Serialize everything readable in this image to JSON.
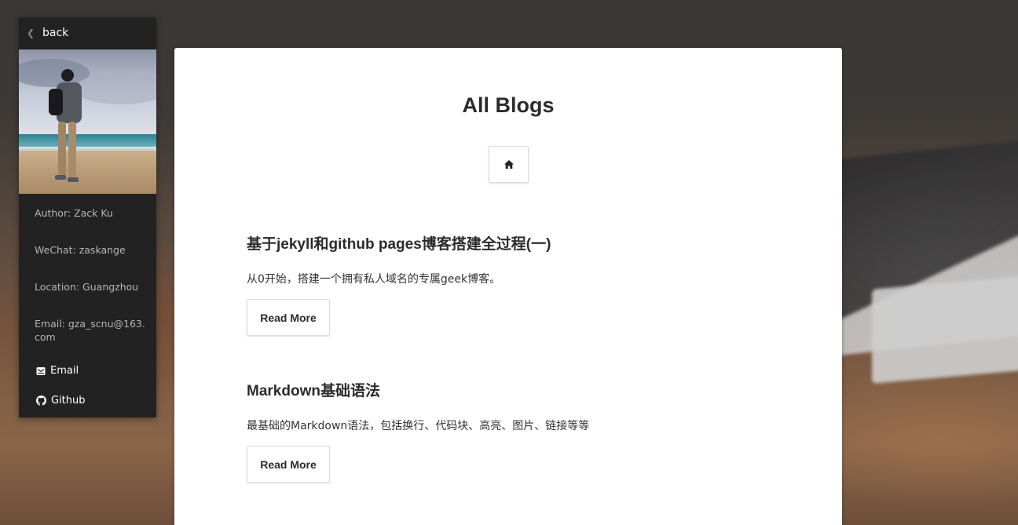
{
  "sidebar": {
    "back_label": "back",
    "author": "Author: Zack Ku",
    "wechat": "WeChat: zaskange",
    "location": "Location: Guangzhou",
    "email_info": "Email: gza_scnu@163.com",
    "links": {
      "email_label": "Email",
      "github_label": "Github"
    }
  },
  "main": {
    "title": "All Blogs",
    "posts": [
      {
        "title": "基于jekyll和github pages博客搭建全过程(一)",
        "excerpt": "从0开始，搭建一个拥有私人域名的专属geek博客。",
        "read_more": "Read More"
      },
      {
        "title": "Markdown基础语法",
        "excerpt": "最基础的Markdown语法，包括换行、代码块、高亮、图片、链接等等",
        "read_more": "Read More"
      }
    ]
  },
  "icons": {
    "back": "chevron-left-icon",
    "home": "home-icon",
    "email": "envelope-icon",
    "github": "github-icon"
  },
  "colors": {
    "sidebar_bg": "#222222",
    "card_bg": "#ffffff",
    "text_dark": "#2b2b2b",
    "info_text": "#b5b5b5"
  }
}
